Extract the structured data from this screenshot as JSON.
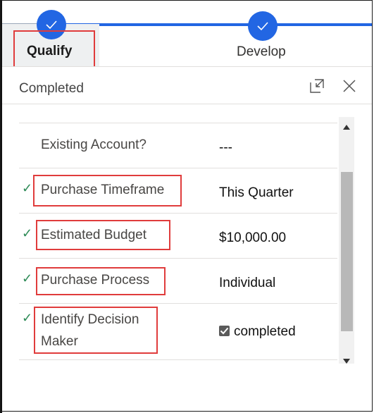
{
  "stages": {
    "qualify": {
      "label": "Qualify",
      "completed": true
    },
    "develop": {
      "label": "Develop",
      "completed": true
    }
  },
  "flyout": {
    "title": "Completed",
    "expand_icon": "expand-icon",
    "close_icon": "close-icon"
  },
  "fields": [
    {
      "label": "Existing Account?",
      "value": "---",
      "checked": false
    },
    {
      "label": "Purchase Timeframe",
      "value": "This Quarter",
      "checked": true
    },
    {
      "label": "Estimated Budget",
      "value": "$10,000.00",
      "checked": true
    },
    {
      "label": "Purchase Process",
      "value": "Individual",
      "checked": true
    },
    {
      "label": "Identify Decision",
      "label2": "Maker",
      "value": "completed",
      "checked": true
    }
  ],
  "colors": {
    "accent": "#2266e3",
    "highlight": "#e03c3c",
    "check": "#2e8b57"
  }
}
